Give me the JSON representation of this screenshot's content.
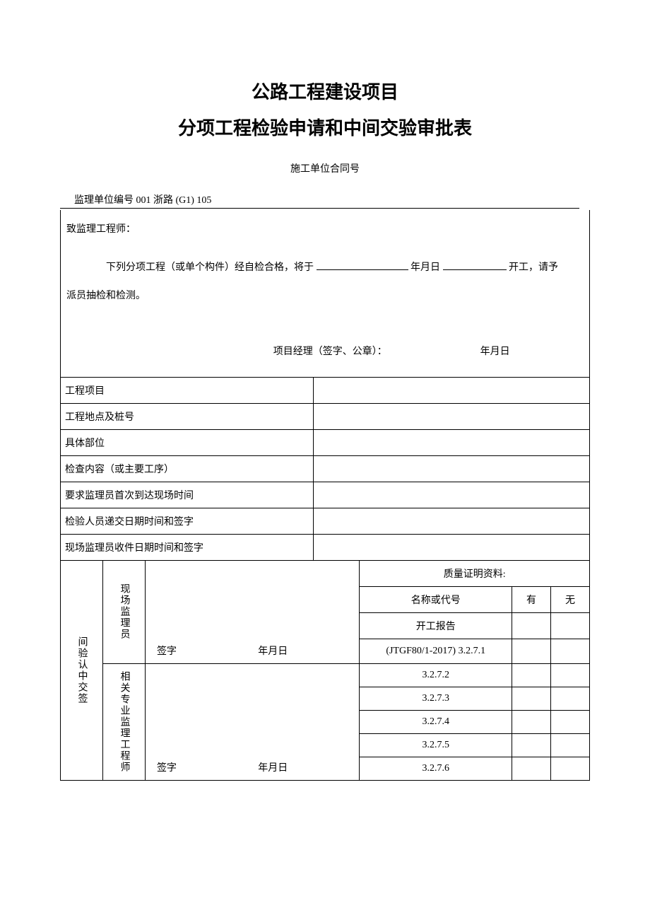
{
  "title_line1": "公路工程建设项目",
  "title_line2": "分项工程检验申请和中间交验审批表",
  "contract_label": "施工单位合同号",
  "supervisor_code": "监理单位编号 001 浙路 (G1) 105",
  "to_engineer": "致监理工程师：",
  "intro_prefix": "下列分项工程（或单个构件）经自检合格，将于",
  "intro_mid": "年月日",
  "intro_suffix": "开工，请予",
  "intro_line2": "派员抽检和检测。",
  "pm_sign": "项目经理（签字、公章）：",
  "pm_date": "年月日",
  "rows": {
    "r1": "工程项目",
    "r2": "工程地点及桩号",
    "r3": "具体部位",
    "r4": "检查内容（或主要工序）",
    "r5": "要求监理员首次到达现场时间",
    "r6": "检验人员递交日期时间和签字",
    "r7": "现场监理员收件日期时间和签字"
  },
  "approval_label": "间验认中交签",
  "role1": "现场监理员",
  "role2": "相关专业监理工程师",
  "sign_label": "签字",
  "sign_date": "年月日",
  "quality": {
    "header": "质量证明资料:",
    "name_col": "名称或代号",
    "yes_col": "有",
    "no_col": "无",
    "items": [
      "开工报告",
      "(JTGF80/1-2017) 3.2.7.1",
      "3.2.7.2",
      "3.2.7.3",
      "3.2.7.4",
      "3.2.7.5",
      "3.2.7.6"
    ]
  }
}
